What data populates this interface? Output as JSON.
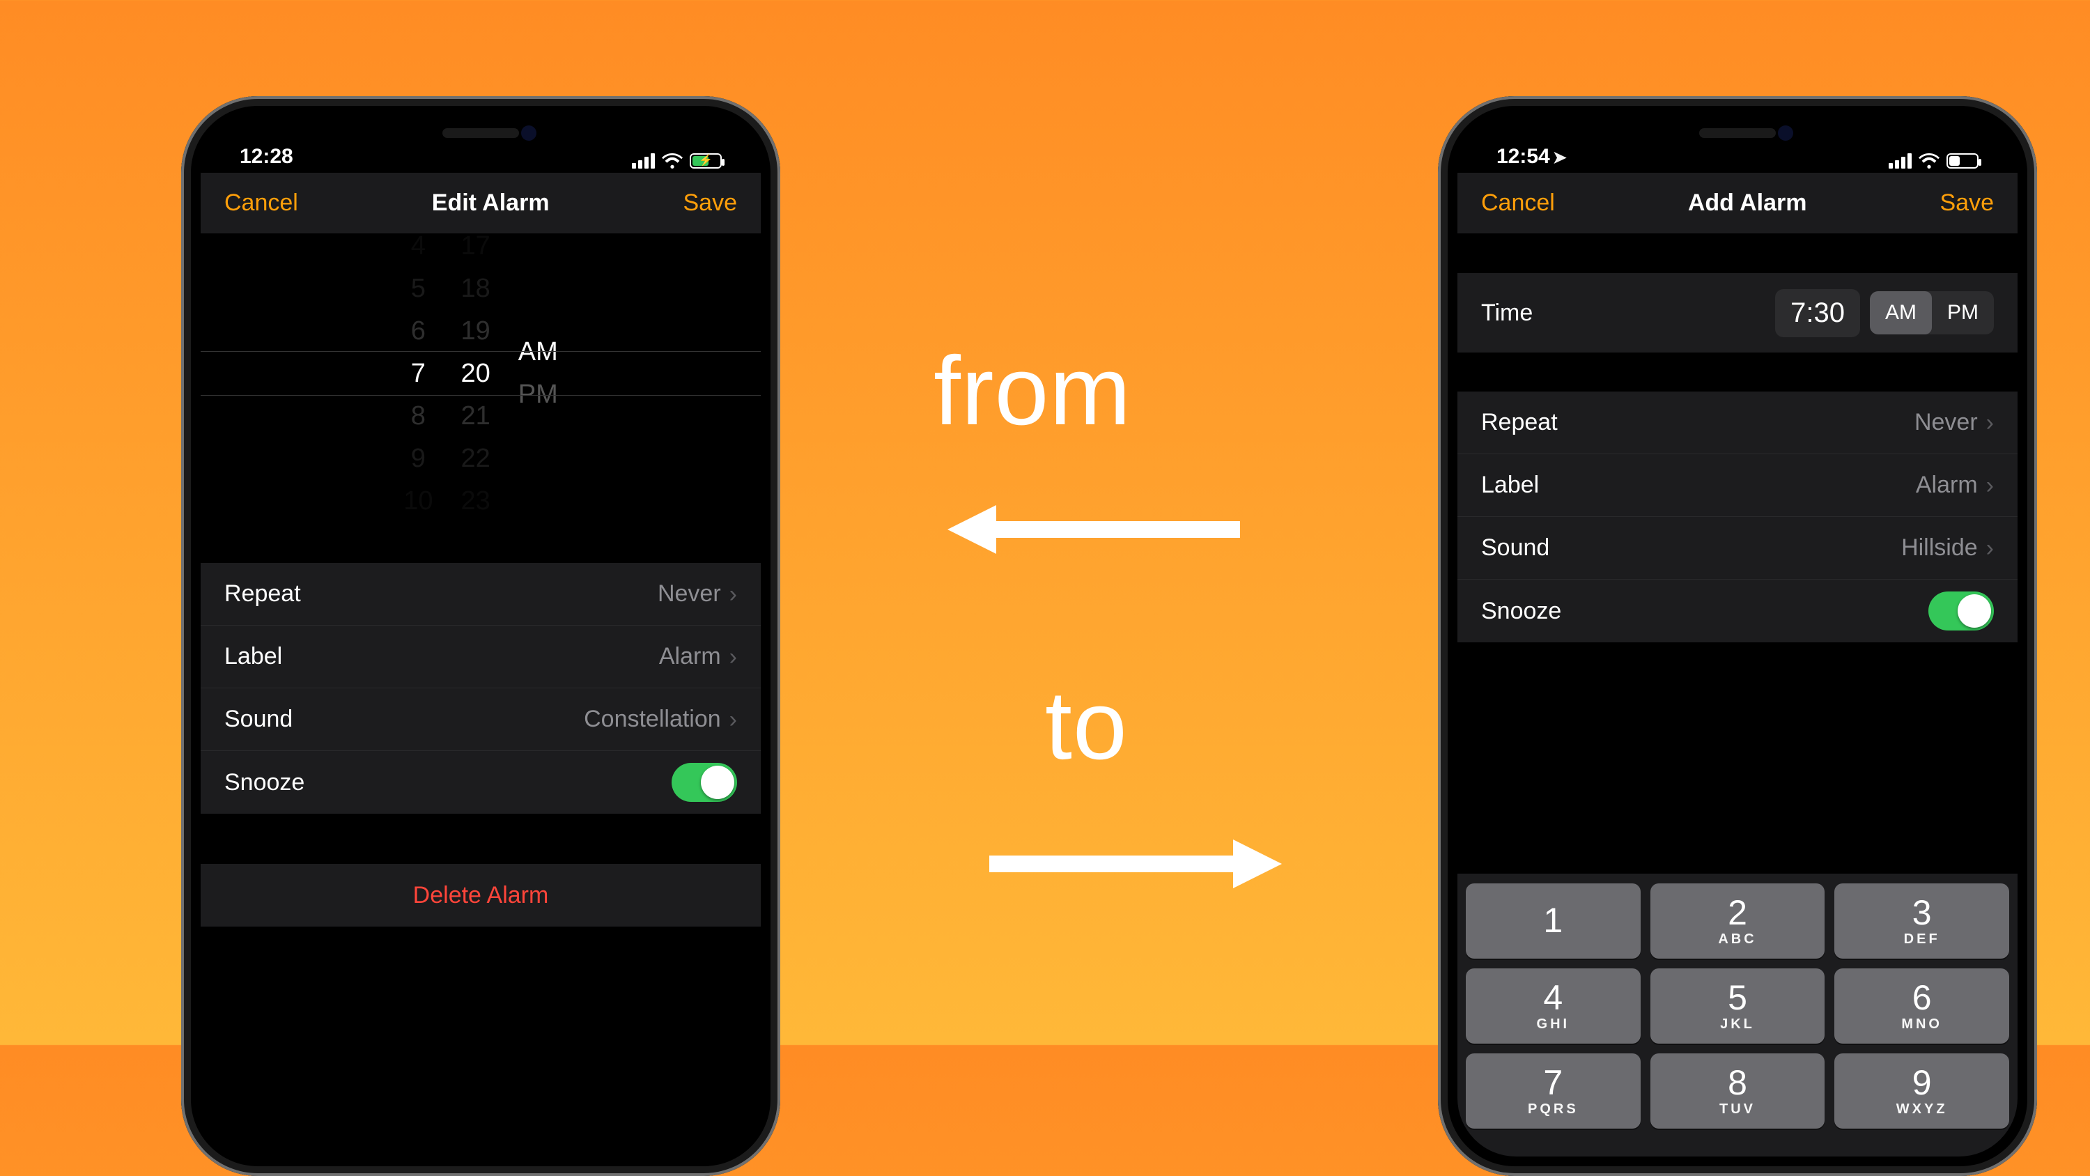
{
  "annotation": {
    "from": "from",
    "to": "to"
  },
  "left": {
    "status": {
      "time": "12:28"
    },
    "nav": {
      "cancel": "Cancel",
      "title": "Edit Alarm",
      "save": "Save"
    },
    "wheel": {
      "hours": [
        "4",
        "5",
        "6",
        "7",
        "8",
        "9",
        "10"
      ],
      "minutes": [
        "17",
        "18",
        "19",
        "20",
        "21",
        "22",
        "23"
      ],
      "ampm": [
        "AM",
        "PM"
      ],
      "selected_hour": "7",
      "selected_minute": "20",
      "selected_ampm": "AM"
    },
    "rows": {
      "repeat": {
        "label": "Repeat",
        "value": "Never"
      },
      "label": {
        "label": "Label",
        "value": "Alarm"
      },
      "sound": {
        "label": "Sound",
        "value": "Constellation"
      },
      "snooze": {
        "label": "Snooze",
        "on": true
      }
    },
    "delete": "Delete Alarm"
  },
  "right": {
    "status": {
      "time": "12:54"
    },
    "nav": {
      "cancel": "Cancel",
      "title": "Add Alarm",
      "save": "Save"
    },
    "time_row": {
      "label": "Time",
      "value": "7:30",
      "ampm": [
        "AM",
        "PM"
      ],
      "active": "AM"
    },
    "rows": {
      "repeat": {
        "label": "Repeat",
        "value": "Never"
      },
      "label": {
        "label": "Label",
        "value": "Alarm"
      },
      "sound": {
        "label": "Sound",
        "value": "Hillside"
      },
      "snooze": {
        "label": "Snooze",
        "on": true
      }
    },
    "keypad": [
      {
        "n": "1",
        "s": ""
      },
      {
        "n": "2",
        "s": "ABC"
      },
      {
        "n": "3",
        "s": "DEF"
      },
      {
        "n": "4",
        "s": "GHI"
      },
      {
        "n": "5",
        "s": "JKL"
      },
      {
        "n": "6",
        "s": "MNO"
      },
      {
        "n": "7",
        "s": "PQRS"
      },
      {
        "n": "8",
        "s": "TUV"
      },
      {
        "n": "9",
        "s": "WXYZ"
      }
    ]
  }
}
